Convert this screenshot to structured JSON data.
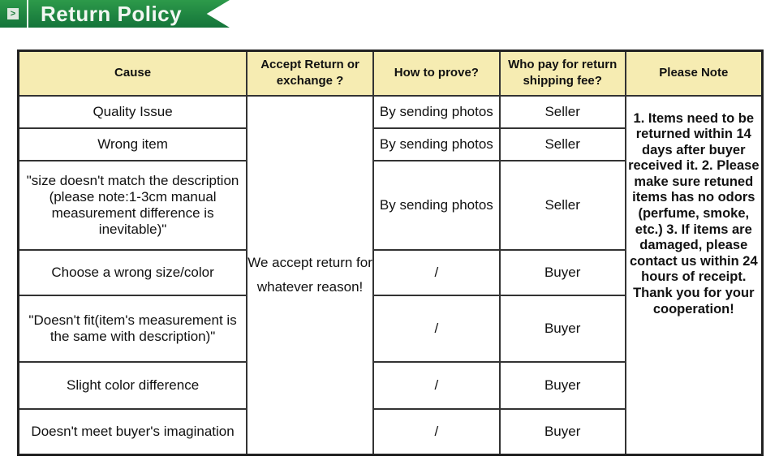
{
  "banner": {
    "title": "Return Policy",
    "icon": "arrow-right-icon"
  },
  "table": {
    "headers": [
      "Cause",
      "Accept Return or exchange ?",
      "How to prove?",
      "Who pay for return shipping fee?",
      "Please Note"
    ],
    "accept": "We accept return for whatever reason!",
    "note": "1. Items need to be returned within 14 days after buyer received it. 2. Please make sure retuned items has no odors (perfume, smoke, etc.) 3. If items are damaged, please contact us within 24 hours of receipt. Thank you for your cooperation!",
    "rows": [
      {
        "cause": "Quality Issue",
        "prove": "By sending photos",
        "payer": "Seller"
      },
      {
        "cause": "Wrong item",
        "prove": "By sending photos",
        "payer": "Seller"
      },
      {
        "cause": "\"size doesn't match the description (please note:1-3cm manual measurement difference is inevitable)\"",
        "prove": "By sending photos",
        "payer": "Seller"
      },
      {
        "cause": "Choose a wrong size/color",
        "prove": "/",
        "payer": "Buyer"
      },
      {
        "cause": "\"Doesn't fit(item's measurement is the same with description)\"",
        "prove": "/",
        "payer": "Buyer"
      },
      {
        "cause": "Slight color difference",
        "prove": "/",
        "payer": "Buyer"
      },
      {
        "cause": "Doesn't meet buyer's imagination",
        "prove": "/",
        "payer": "Buyer"
      }
    ]
  },
  "colors": {
    "banner": "#1d843f",
    "header": "#f6ecb2"
  }
}
